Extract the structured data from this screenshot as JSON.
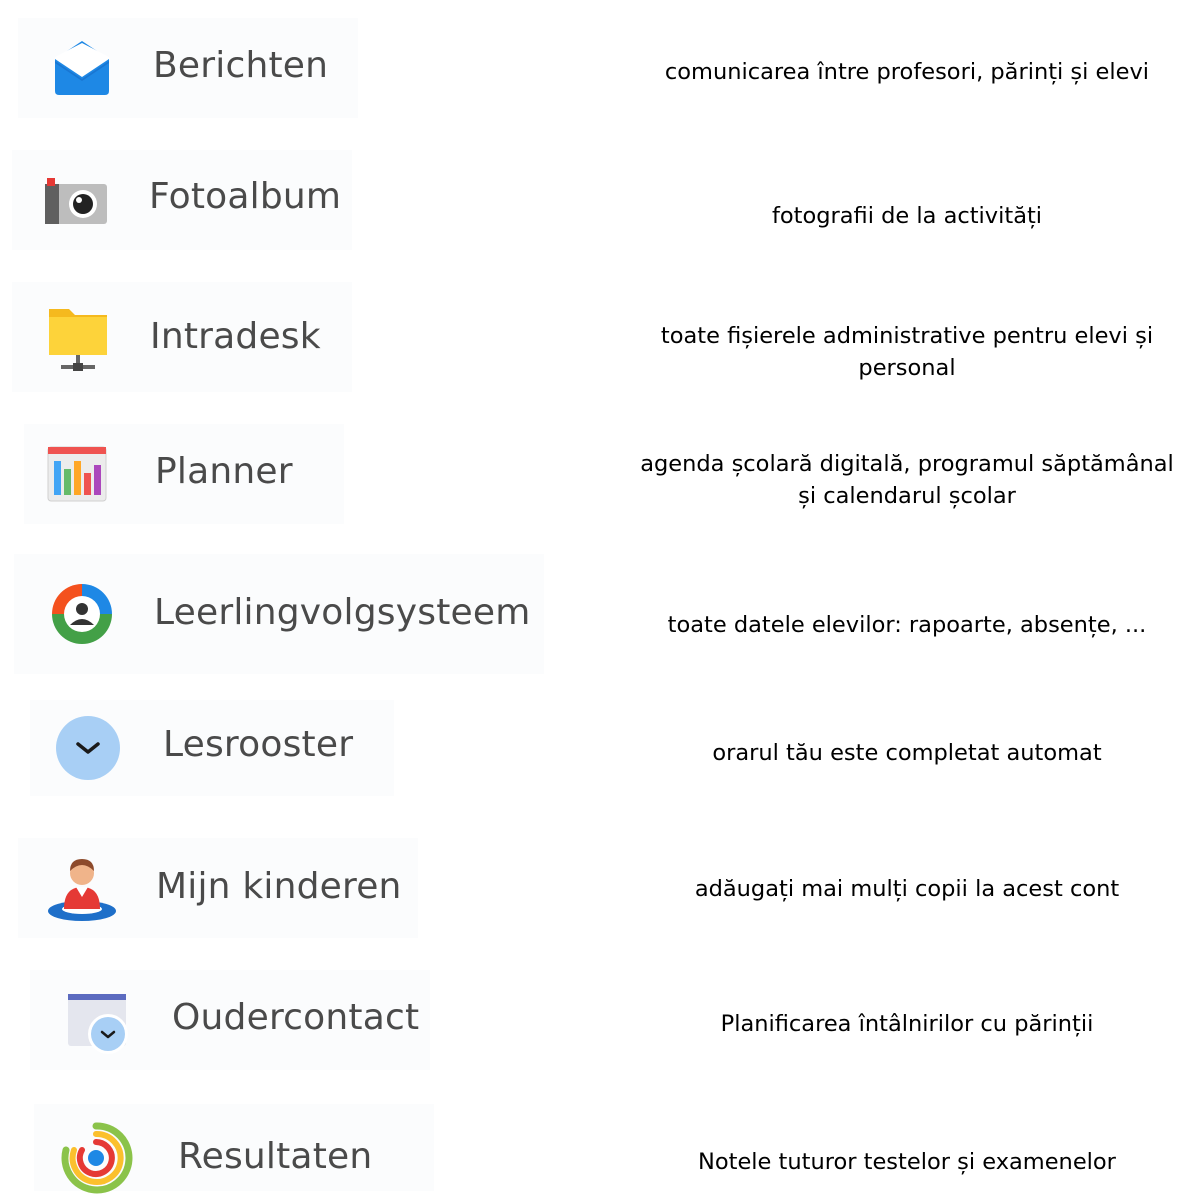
{
  "modules": [
    {
      "id": "berichten",
      "label": "Berichten",
      "icon": "envelope-icon",
      "description": "comunicarea între profesori, părinți  și elevi"
    },
    {
      "id": "fotoalbum",
      "label": "Fotoalbum",
      "icon": "camera-icon",
      "description": "fotografii de la activități"
    },
    {
      "id": "intradesk",
      "label": "Intradesk",
      "icon": "folder-network-icon",
      "description": "toate fișierele administrative pentru elevi și personal"
    },
    {
      "id": "planner",
      "label": "Planner",
      "icon": "calendar-chart-icon",
      "description": "agenda școlară digitală, programul săptămânal și calendarul școlar"
    },
    {
      "id": "leerlingvolgsysteem",
      "label": "Leerlingvolgsysteem",
      "icon": "student-profile-icon",
      "description": "toate datele elevilor: rapoarte, absențe, ..."
    },
    {
      "id": "lesrooster",
      "label": "Lesrooster",
      "icon": "clock-icon",
      "description": "orarul tău este completat automat"
    },
    {
      "id": "mijn-kinderen",
      "label": "Mijn kinderen",
      "icon": "child-avatar-icon",
      "description": "adăugați mai mulți copii la acest cont"
    },
    {
      "id": "oudercontact",
      "label": "Oudercontact",
      "icon": "calendar-clock-icon",
      "description": "Planificarea întâlnirilor cu părinții"
    },
    {
      "id": "resultaten",
      "label": "Resultaten",
      "icon": "results-rings-icon",
      "description": "Notele tuturor testelor și examenelor"
    }
  ],
  "colors": {
    "envelope": "#1e88e5",
    "camera_body": "#bdbdbd",
    "camera_dark": "#5f5f5f",
    "folder": "#fbc52d",
    "label_text": "#4a4a4a"
  }
}
